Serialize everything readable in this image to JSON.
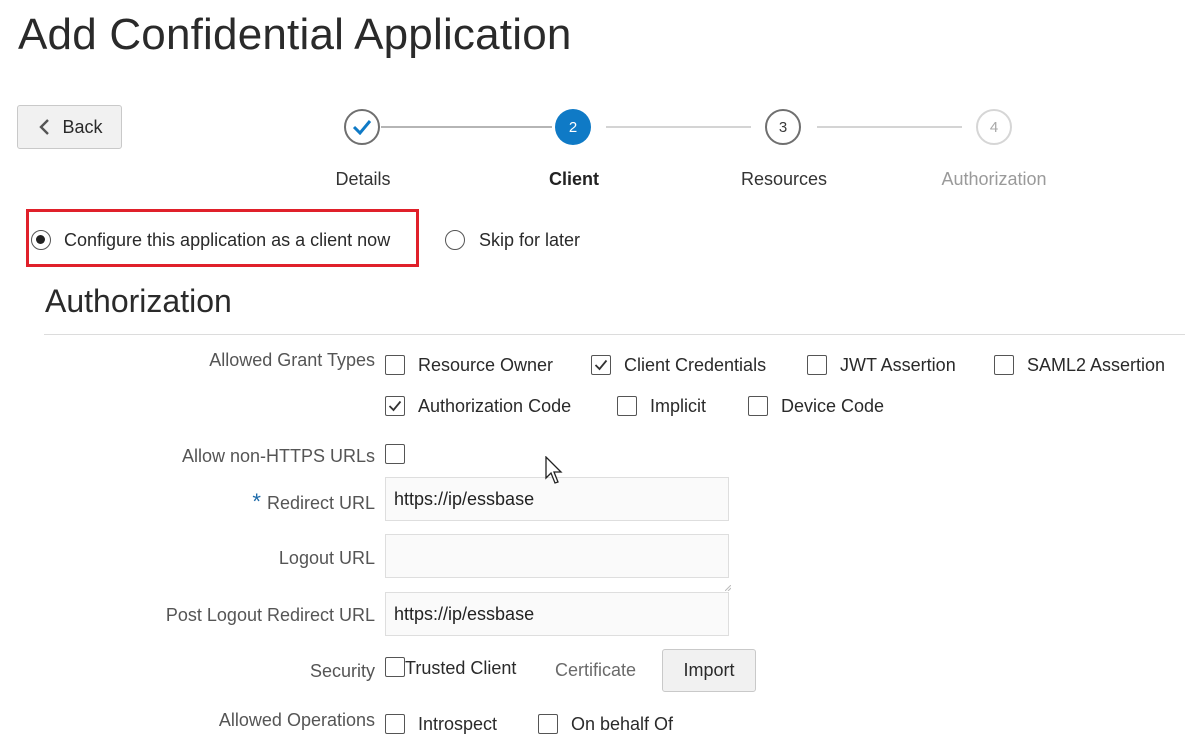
{
  "page_title": "Add Confidential Application",
  "back_label": "Back",
  "steps": [
    {
      "number": "",
      "label": "Details",
      "state": "done"
    },
    {
      "number": "2",
      "label": "Client",
      "state": "current"
    },
    {
      "number": "3",
      "label": "Resources",
      "state": "next"
    },
    {
      "number": "4",
      "label": "Authorization",
      "state": "disabled"
    }
  ],
  "client_choice": {
    "configure_now_label": "Configure this application as a client now",
    "configure_now_selected": true,
    "skip_label": "Skip for later",
    "skip_selected": false
  },
  "section_title": "Authorization",
  "grant_types": {
    "label": "Allowed Grant Types",
    "options": [
      {
        "label": "Resource Owner",
        "checked": false
      },
      {
        "label": "Client Credentials",
        "checked": true
      },
      {
        "label": "JWT Assertion",
        "checked": false
      },
      {
        "label": "SAML2 Assertion",
        "checked": false
      },
      {
        "label": "Authorization Code",
        "checked": true
      },
      {
        "label": "Implicit",
        "checked": false
      },
      {
        "label": "Device Code",
        "checked": false
      }
    ]
  },
  "non_https": {
    "label": "Allow non-HTTPS URLs",
    "checked": false
  },
  "redirect_url": {
    "required_mark": "*",
    "label": "Redirect URL",
    "value": "https://ip/essbase"
  },
  "logout_url": {
    "label": "Logout URL",
    "value": ""
  },
  "post_logout_redirect_url": {
    "label": "Post Logout Redirect URL",
    "value": "https://ip/essbase"
  },
  "security": {
    "label": "Security",
    "trusted_client_label": "Trusted Client",
    "trusted_client_checked": false,
    "certificate_label": "Certificate",
    "import_label": "Import"
  },
  "allowed_operations": {
    "label": "Allowed Operations",
    "options": [
      {
        "label": "Introspect",
        "checked": false
      },
      {
        "label": "On behalf Of",
        "checked": false
      }
    ]
  },
  "colors": {
    "accent": "#0f7ac6",
    "highlight_border": "#e0202a",
    "required_star": "#1c6aa9"
  }
}
